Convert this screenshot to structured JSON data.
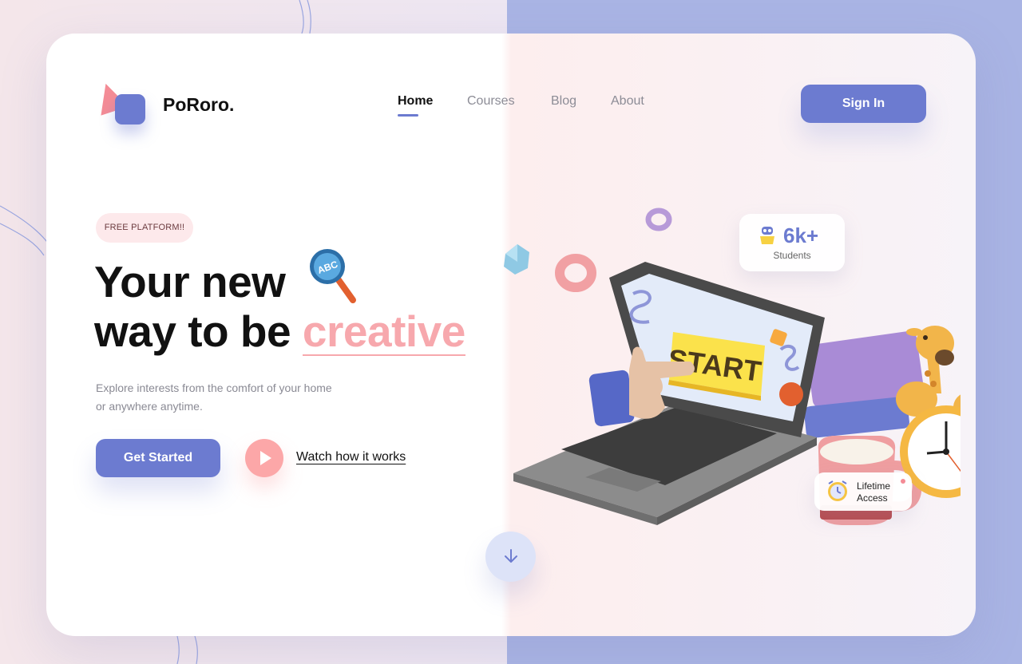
{
  "brand": {
    "name": "PoRoro."
  },
  "nav": {
    "items": [
      {
        "label": "Home",
        "active": true
      },
      {
        "label": "Courses",
        "active": false
      },
      {
        "label": "Blog",
        "active": false
      },
      {
        "label": "About",
        "active": false
      }
    ],
    "signin_label": "Sign In"
  },
  "hero": {
    "badge": "FREE PLATFORM!!",
    "headline_line1": "Your new",
    "headline_line2_prefix": "way to be ",
    "headline_accent": "creative",
    "subtext": "Explore interests from the comfort of your home or anywhere anytime.",
    "cta_primary": "Get Started",
    "cta_secondary": "Watch how it works"
  },
  "illustration": {
    "screen_label": "START",
    "magnifier_label": "ABC",
    "stats": {
      "value": "6k+",
      "label": "Students"
    },
    "access": {
      "line1": "Lifetime",
      "line2": "Access"
    }
  },
  "icons": {
    "play": "play-icon",
    "scroll": "arrow-down-icon",
    "students": "robot-icon",
    "access": "alarm-clock-icon"
  },
  "colors": {
    "primary": "#6c7bd0",
    "accent_pink": "#f7a8ad",
    "play_button": "#fca7a8",
    "background_right": "#a9b4e4"
  }
}
